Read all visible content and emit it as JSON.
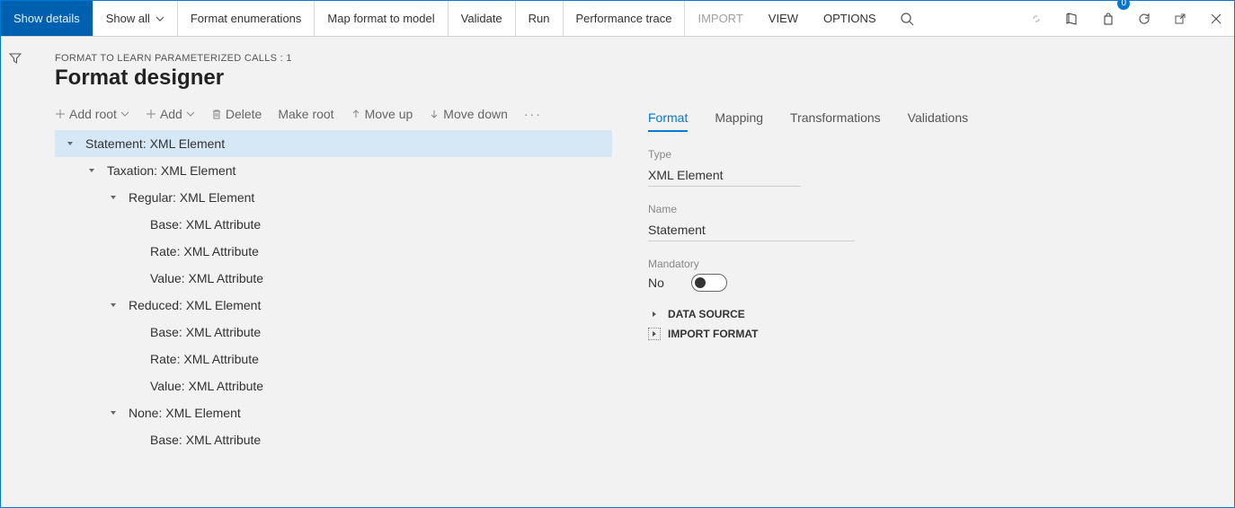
{
  "topbar": {
    "show_details": "Show details",
    "show_all": "Show all",
    "format_enumerations": "Format enumerations",
    "map_format_to_model": "Map format to model",
    "validate": "Validate",
    "run": "Run",
    "performance_trace": "Performance trace",
    "import": "IMPORT",
    "view": "VIEW",
    "options": "OPTIONS",
    "badge_count": "0"
  },
  "breadcrumb": "FORMAT TO LEARN PARAMETERIZED CALLS : 1",
  "page_title": "Format designer",
  "toolbar": {
    "add_root": "Add root",
    "add": "Add",
    "delete": "Delete",
    "make_root": "Make root",
    "move_up": "Move up",
    "move_down": "Move down"
  },
  "tree": [
    {
      "level": 0,
      "expanded": true,
      "text": "Statement: XML Element",
      "selected": true
    },
    {
      "level": 1,
      "expanded": true,
      "text": "Taxation: XML Element"
    },
    {
      "level": 2,
      "expanded": true,
      "text": "Regular: XML Element"
    },
    {
      "level": 3,
      "expanded": null,
      "text": "Base: XML Attribute"
    },
    {
      "level": 3,
      "expanded": null,
      "text": "Rate: XML Attribute"
    },
    {
      "level": 3,
      "expanded": null,
      "text": "Value: XML Attribute"
    },
    {
      "level": 2,
      "expanded": true,
      "text": "Reduced: XML Element"
    },
    {
      "level": 3,
      "expanded": null,
      "text": "Base: XML Attribute"
    },
    {
      "level": 3,
      "expanded": null,
      "text": "Rate: XML Attribute"
    },
    {
      "level": 3,
      "expanded": null,
      "text": "Value: XML Attribute"
    },
    {
      "level": 2,
      "expanded": true,
      "text": "None: XML Element"
    },
    {
      "level": 3,
      "expanded": null,
      "text": "Base: XML Attribute"
    }
  ],
  "tabs": {
    "format": "Format",
    "mapping": "Mapping",
    "transformations": "Transformations",
    "validations": "Validations"
  },
  "panel": {
    "type_label": "Type",
    "type_value": "XML Element",
    "name_label": "Name",
    "name_value": "Statement",
    "mandatory_label": "Mandatory",
    "mandatory_value": "No",
    "data_source": "DATA SOURCE",
    "import_format": "IMPORT FORMAT"
  }
}
